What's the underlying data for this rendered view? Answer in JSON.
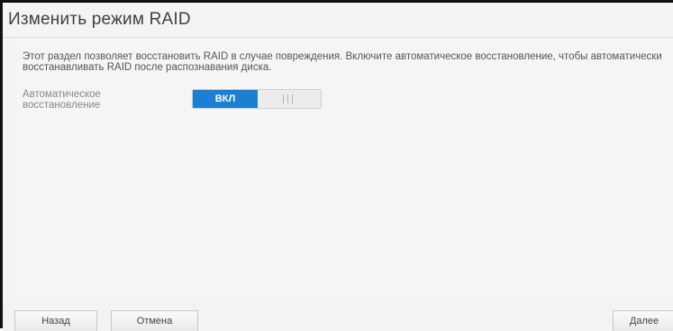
{
  "dialog": {
    "title": "Изменить режим RAID",
    "description": "Этот раздел позволяет восстановить RAID в случае повреждения. Включите автоматическое восстановление, чтобы автоматически восстанавливать RAID после распознавания диска.",
    "auto_rebuild": {
      "label": "Автоматическое восстановление",
      "on_label": "ВКЛ",
      "state": "on"
    }
  },
  "footer": {
    "back_label": "Назад",
    "cancel_label": "Отмена",
    "next_label": "Далее"
  }
}
